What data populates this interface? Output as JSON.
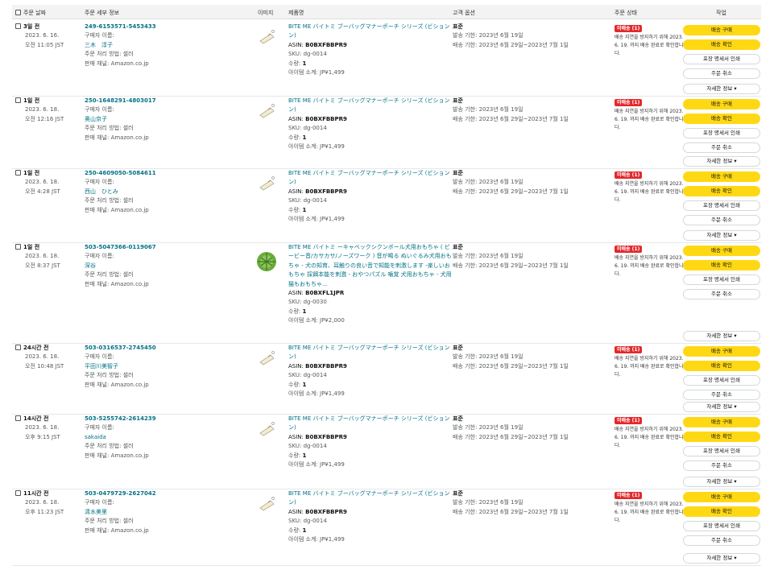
{
  "columns": {
    "date": "주문 날짜",
    "details": "주문 세부 정보",
    "image": "이미지",
    "product": "제품명",
    "options": "고객 옵션",
    "status": "주문 상태",
    "action": "작업"
  },
  "labels": {
    "buyer": "구매자 이름:",
    "fulfillment": "주문 처리 방법: 셀러",
    "channel": "판매 채널: Amazon.co.jp",
    "asin_prefix": "ASIN: ",
    "sku_prefix": "SKU: ",
    "qty_prefix": "수량: ",
    "subtotal_prefix": "아이템 소계: ",
    "ship_by": "발송 기한: 2023년 6월 19일",
    "deliver_by": "배송 기한: 2023년 6월 29일~2023년 7월 1일",
    "option": "표준",
    "badge": "미배송 (1)",
    "status_note": "배송 지연을 방지하기 위해 2023. 6. 19. 까지 배송 완료로 확인합니다."
  },
  "buttons": {
    "buy_shipping": "배송 구매",
    "confirm_shipment": "배송 확인",
    "print_slip": "포장 명세서 인쇄",
    "cancel": "주문 취소",
    "details": "자세한 정보 ▾"
  },
  "orders": [
    {
      "age": "3일 전",
      "date": "2023. 6. 16.",
      "time": "오전 11:05 JST",
      "order_id": "249-6153571-5453433",
      "buyer": "三木　淳子",
      "product": "BITE ME バイトミ ブーバッグマナーポーチ シリーズ (ビションン)",
      "asin": "B0BXFBBPR9",
      "sku": "dg-0014",
      "qty": "1",
      "subtotal": "JP¥1,499"
    },
    {
      "age": "1일 전",
      "date": "2023. 6. 18.",
      "time": "오전 12:16 JST",
      "order_id": "250-1648291-4803017",
      "buyer": "奥山京子",
      "product": "BITE ME バイトミ ブーバッグマナーポーチ シリーズ (ビションン)",
      "asin": "B0BXFBBPR9",
      "sku": "dg-0014",
      "qty": "1",
      "subtotal": "JP¥1,499"
    },
    {
      "age": "1일 전",
      "date": "2023. 6. 18.",
      "time": "오전 4:28 JST",
      "order_id": "250-4609050-5084611",
      "buyer": "西山　ひとみ",
      "product": "BITE ME バイトミ ブーバッグマナーポーチ シリーズ (ビションン)",
      "asin": "B0BXFBBPR9",
      "sku": "dg-0014",
      "qty": "1",
      "subtotal": "JP¥1,499"
    },
    {
      "age": "1일 전",
      "date": "2023. 6. 18.",
      "time": "오전 8:37 JST",
      "order_id": "503-5047366-0119067",
      "buyer": "深谷",
      "product": "BITE ME バイトミ ーキャベックシクンボール犬用おもちゃ ( ビービー音/カサカサ/ノーズワーク ) 音が鳴る ぬいぐるみ犬用おもちゃ - 犬の知育、耳触りの良い音で知能を刺激します -楽しいおもちゃ 採餌本能を刺激 - おやつパズル 噛覚 犬用おもちゃ - 犬用 猫もおもちゃ...",
      "asin": "B0BXFL1JPR",
      "sku": "dg-0030",
      "qty": "1",
      "subtotal": "JP¥2,000"
    },
    {
      "age": "24시간 전",
      "date": "2023. 6. 18.",
      "time": "오전 10:48 JST",
      "order_id": "503-0316537-2745450",
      "buyer": "平田川美智子",
      "product": "BITE ME バイトミ ブーバッグマナーポーチ シリーズ (ビションン)",
      "asin": "B0BXFBBPR9",
      "sku": "dg-0014",
      "qty": "1",
      "subtotal": "JP¥1,499"
    },
    {
      "age": "14시간 전",
      "date": "2023. 6. 18.",
      "time": "오후 9:15 JST",
      "order_id": "503-5255742-2614239",
      "buyer": "sakaida",
      "product": "BITE ME バイトミ ブーバッグマナーポーチ シリーズ (ビションン)",
      "asin": "B0BXFBBPR9",
      "sku": "dg-0014",
      "qty": "1",
      "subtotal": "JP¥1,499"
    },
    {
      "age": "11시간 전",
      "date": "2023. 6. 18.",
      "time": "오후 11:23 JST",
      "order_id": "503-0479729-2627042",
      "buyer": "清水美里",
      "product": "BITE ME バイトミ ブーバッグマナーポーチ シリーズ (ビションン)",
      "asin": "B0BXFBBPR9",
      "sku": "dg-0014",
      "qty": "1",
      "subtotal": "JP¥1,499"
    }
  ]
}
